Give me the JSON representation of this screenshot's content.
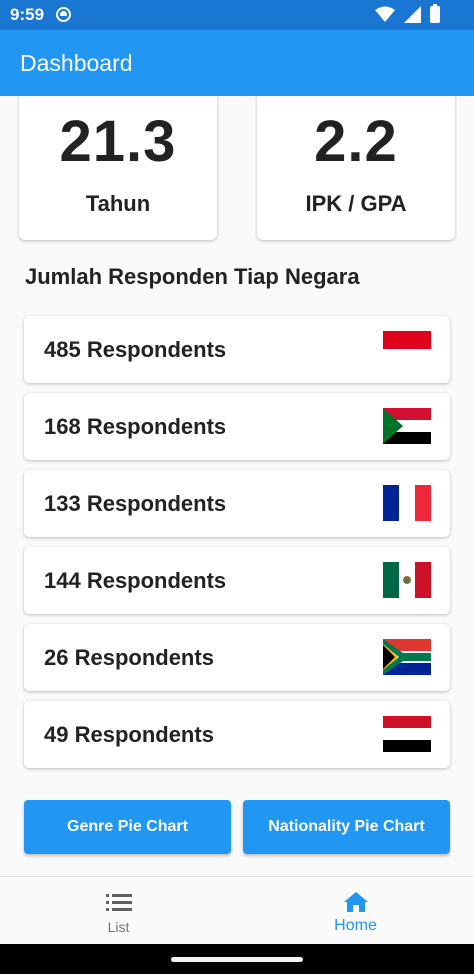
{
  "status_bar": {
    "time": "9:59"
  },
  "app_bar": {
    "title": "Dashboard"
  },
  "stats": [
    {
      "value": "21.3",
      "label": "Tahun"
    },
    {
      "value": "2.2",
      "label": "IPK / GPA"
    }
  ],
  "section_title": "Jumlah Responden Tiap Negara",
  "countries": [
    {
      "text": "485 Respondents",
      "flag": "indonesia-flag"
    },
    {
      "text": "168 Respondents",
      "flag": "sudan-flag"
    },
    {
      "text": "133 Respondents",
      "flag": "france-flag"
    },
    {
      "text": "144 Respondents",
      "flag": "mexico-flag"
    },
    {
      "text": "26 Respondents",
      "flag": "south-africa-flag"
    },
    {
      "text": "49 Respondents",
      "flag": "yemen-flag"
    }
  ],
  "buttons": {
    "genre": "Genre Pie Chart",
    "nationality": "Nationality Pie Chart"
  },
  "bottom_nav": {
    "list_label": "List",
    "home_label": "Home"
  },
  "colors": {
    "primary": "#2196F3",
    "status_bar": "#1976D2"
  }
}
